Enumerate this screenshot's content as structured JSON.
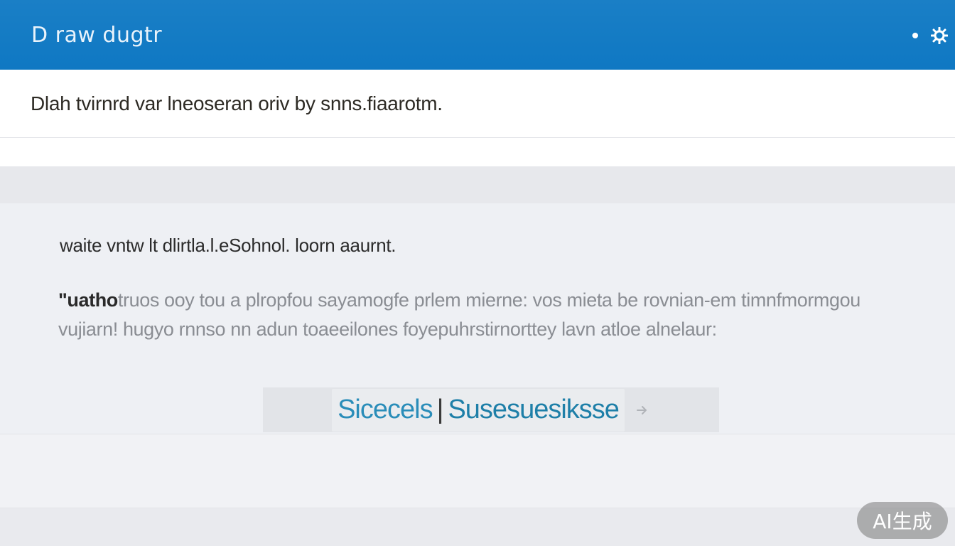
{
  "header": {
    "app_title": "D  raw  dugtr",
    "icons": [
      "dot-icon",
      "gear-icon"
    ]
  },
  "subtitle": "Dlah tvirnrd var lneoseran oriv by snns.fiaarotm.",
  "content": {
    "heading": "waite vntw lt dlirtla.l.eSohnol. loorn aaurnt.",
    "body_lead": "\"uatho",
    "body_rest": "truos ooy tou a plropfou sayamogfe prlem mierne: vos mieta be rovnian-em timnfmormgou vujiarn! hugyo rnnso nn adun toaeeilones foyepuhrstirnorttey lavn atloe alnelaur:"
  },
  "status": {
    "left_label": "Sicecels",
    "separator": "|",
    "right_label": "Susesuesiksse"
  },
  "watermark": "AI生成",
  "colors": {
    "header": "#1a7fc6",
    "accent": "#2a8db9"
  }
}
